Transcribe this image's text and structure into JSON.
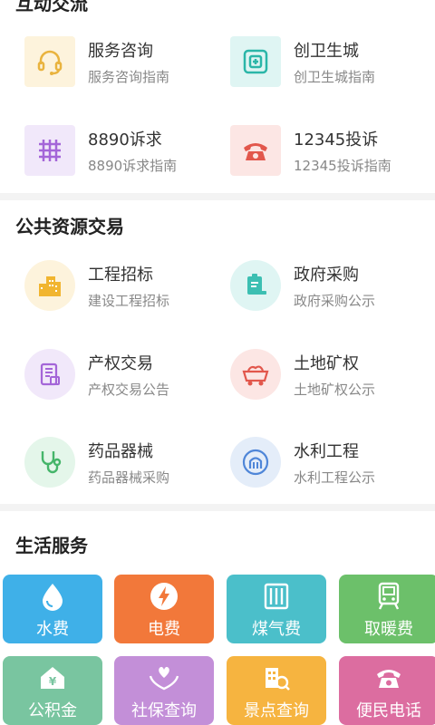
{
  "sections": {
    "interaction": {
      "title": "互动交流",
      "items": [
        {
          "title": "服务咨询",
          "subtitle": "服务咨询指南",
          "icon": "headset-icon"
        },
        {
          "title": "创卫生城",
          "subtitle": "创卫生城指南",
          "icon": "medical-cross-icon"
        },
        {
          "title": "8890诉求",
          "subtitle": "8890诉求指南",
          "icon": "grid-hash-icon"
        },
        {
          "title": "12345投诉",
          "subtitle": "12345投诉指南",
          "icon": "telephone-icon"
        }
      ]
    },
    "trading": {
      "title": "公共资源交易",
      "items": [
        {
          "title": "工程招标",
          "subtitle": "建设工程招标",
          "icon": "building-icon"
        },
        {
          "title": "政府采购",
          "subtitle": "政府采购公示",
          "icon": "clipboard-icon"
        },
        {
          "title": "产权交易",
          "subtitle": "产权交易公告",
          "icon": "property-document-icon"
        },
        {
          "title": "土地矿权",
          "subtitle": "土地矿权公示",
          "icon": "mine-cart-icon"
        },
        {
          "title": "药品器械",
          "subtitle": "药品器械采购",
          "icon": "stethoscope-icon"
        },
        {
          "title": "水利工程",
          "subtitle": "水利工程公示",
          "icon": "water-gate-icon"
        }
      ]
    },
    "life": {
      "title": "生活服务",
      "tiles": [
        {
          "label": "水费",
          "icon": "water-drop-icon",
          "color": "#3fb0e8"
        },
        {
          "label": "电费",
          "icon": "lightning-icon",
          "color": "#f2783a"
        },
        {
          "label": "煤气费",
          "icon": "heater-icon",
          "color": "#4bbfca"
        },
        {
          "label": "取暖费",
          "icon": "train-icon",
          "color": "#6cc06a"
        },
        {
          "label": "公积金",
          "icon": "house-yuan-icon",
          "color": "#79c5a0"
        },
        {
          "label": "社保查询",
          "icon": "heart-hands-icon",
          "color": "#c38fd8"
        },
        {
          "label": "景点查询",
          "icon": "building-search-icon",
          "color": "#f6b440"
        },
        {
          "label": "便民电话",
          "icon": "telephone-icon",
          "color": "#dc6da0"
        }
      ]
    }
  }
}
